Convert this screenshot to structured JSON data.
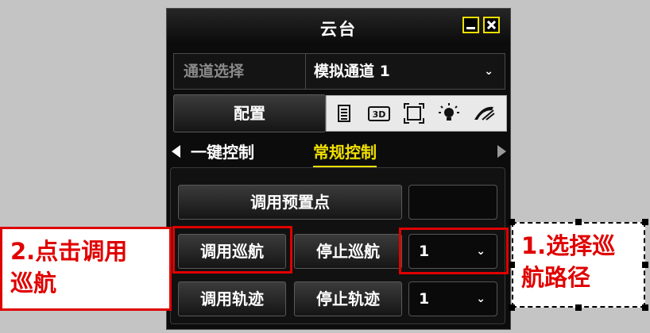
{
  "window": {
    "title": "云台"
  },
  "channel": {
    "label": "通道选择",
    "value": "模拟通道 1"
  },
  "config_button": "配置",
  "toolbar_icons": [
    "list-icon",
    "3d-icon",
    "focus-frame-icon",
    "light-icon",
    "wiper-icon"
  ],
  "tabs": [
    {
      "label": "一键控制",
      "active": false
    },
    {
      "label": "常规控制",
      "active": true
    }
  ],
  "preset": {
    "button": "调用预置点",
    "value": ""
  },
  "cruise": {
    "call": "调用巡航",
    "stop": "停止巡航",
    "path": "1"
  },
  "track": {
    "call": "调用轨迹",
    "stop": "停止轨迹",
    "path": "1"
  },
  "annotations": {
    "step2_line1": "2.点击调用",
    "step2_line2": "巡航",
    "step1_line1": "1.选择巡",
    "step1_line2": "航路径"
  },
  "colors": {
    "active_tab": "#f0e000",
    "annotation": "#e00000",
    "panel_bg": "#0c0c0c"
  }
}
